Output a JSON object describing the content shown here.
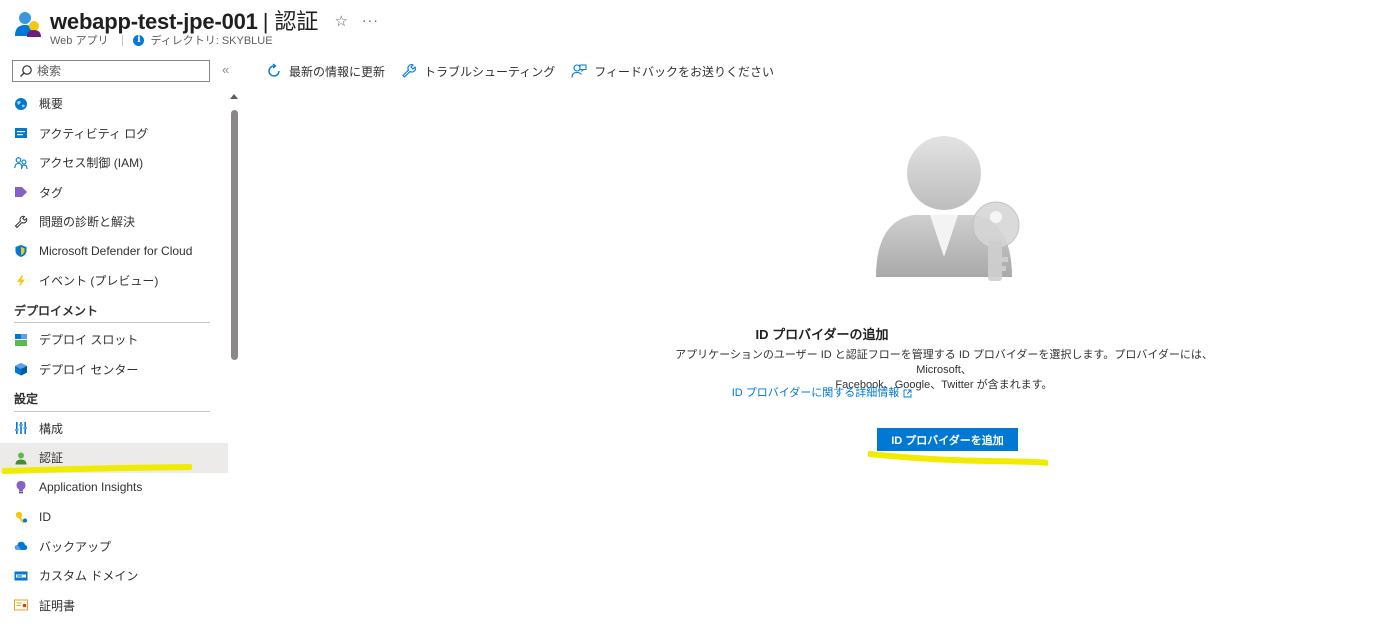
{
  "header": {
    "resource_name": "webapp-test-jpe-001",
    "separator": "|",
    "page_name": "認証",
    "star": "☆",
    "more": "···",
    "resource_type": "Web アプリ",
    "directory": "ディレクトリ: SKYBLUE"
  },
  "sidebar": {
    "search_placeholder": "検索",
    "collapse": "«",
    "items": [
      {
        "label": "概要",
        "icon": "globe-icon"
      },
      {
        "label": "アクティビティ ログ",
        "icon": "activity-log-icon"
      },
      {
        "label": "アクセス制御 (IAM)",
        "icon": "people-icon"
      },
      {
        "label": "タグ",
        "icon": "tag-icon"
      },
      {
        "label": "問題の診断と解決",
        "icon": "wrench-icon"
      },
      {
        "label": "Microsoft Defender for Cloud",
        "icon": "shield-icon"
      },
      {
        "label": "イベント (プレビュー)",
        "icon": "lightning-icon"
      }
    ],
    "section_deploy": "デプロイメント",
    "deploy_items": [
      {
        "label": "デプロイ スロット",
        "icon": "slots-icon"
      },
      {
        "label": "デプロイ センター",
        "icon": "cube-icon"
      }
    ],
    "section_settings": "設定",
    "settings_items": [
      {
        "label": "構成",
        "icon": "sliders-icon"
      },
      {
        "label": "認証",
        "icon": "person-icon",
        "active": true
      },
      {
        "label": "Application Insights",
        "icon": "lightbulb-icon"
      },
      {
        "label": "ID",
        "icon": "key-icon"
      },
      {
        "label": "バックアップ",
        "icon": "cloud-icon"
      },
      {
        "label": "カスタム ドメイン",
        "icon": "domain-icon"
      },
      {
        "label": "証明書",
        "icon": "certificate-icon"
      }
    ]
  },
  "toolbar": {
    "refresh": "最新の情報に更新",
    "troubleshoot": "トラブルシューティング",
    "feedback": "フィードバックをお送りください"
  },
  "main": {
    "title": "ID プロバイダーの追加",
    "description_line1": "アプリケーションのユーザー ID と認証フローを管理する ID プロバイダーを選択します。プロバイダーには、Microsoft、",
    "description_line2": "Facebook、Google、Twitter が含まれます。",
    "learn_more": "ID プロバイダーに関する詳細情報",
    "add_button": "ID プロバイダーを追加"
  },
  "colors": {
    "accent": "#0078d4",
    "highlight": "#f0eb00",
    "active_bg": "#edebe9"
  }
}
